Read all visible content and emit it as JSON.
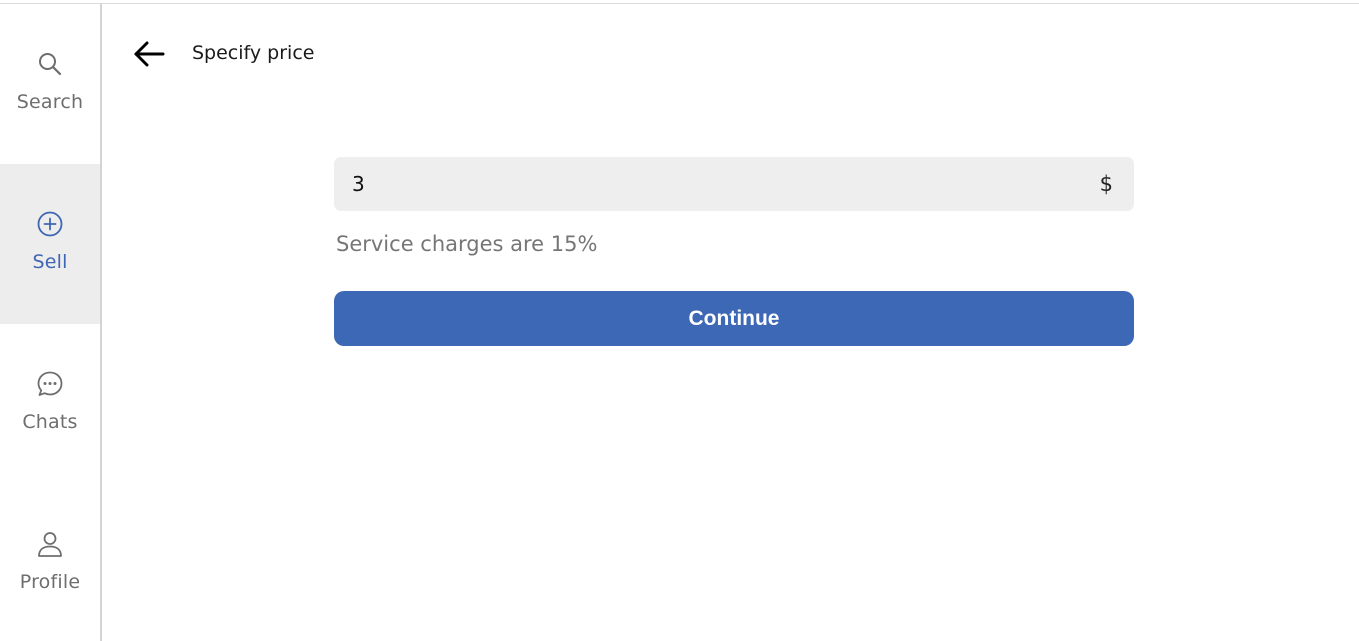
{
  "sidebar": {
    "items": [
      {
        "label": "Search",
        "icon": "search-icon",
        "active": false
      },
      {
        "label": "Sell",
        "icon": "plus-circle-icon",
        "active": true
      },
      {
        "label": "Chats",
        "icon": "chat-bubble-icon",
        "active": false
      },
      {
        "label": "Profile",
        "icon": "user-icon",
        "active": false
      }
    ]
  },
  "header": {
    "back_icon": "arrow-left-icon",
    "title": "Specify price"
  },
  "price": {
    "value": "3",
    "currency": "$"
  },
  "hint": "Service charges are 15%",
  "continue_label": "Continue",
  "colors": {
    "accent": "#3d68b6",
    "active_bg": "#ededed",
    "muted_text": "#6e6e6e",
    "input_bg": "#eeeeee"
  }
}
